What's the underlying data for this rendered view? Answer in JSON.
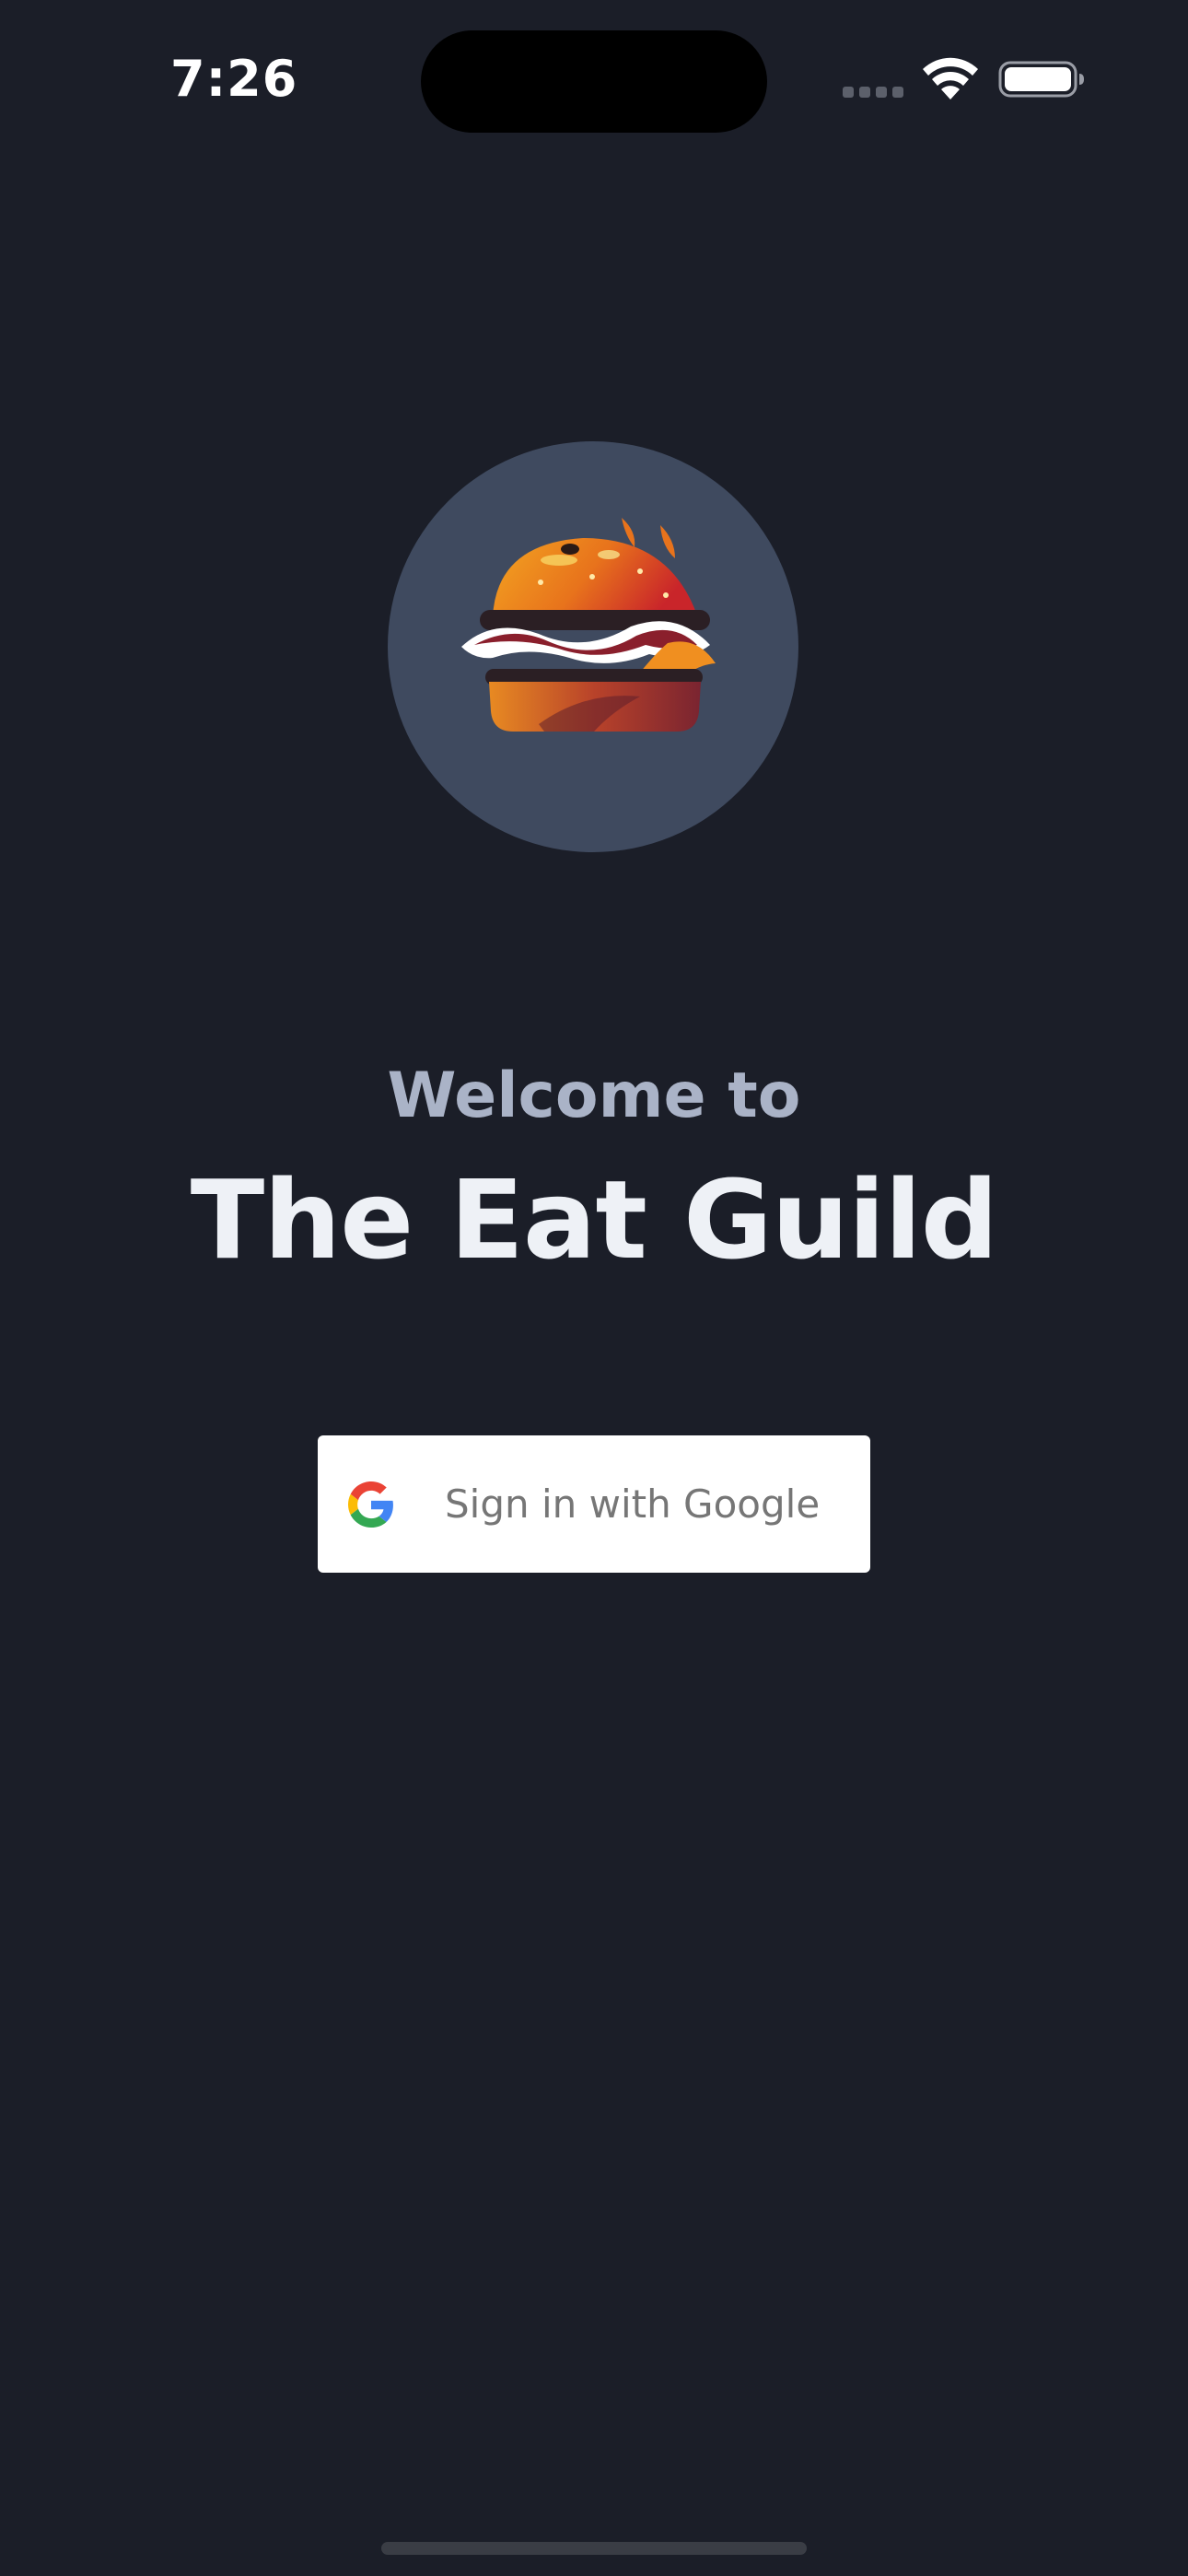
{
  "status_bar": {
    "time": "7:26",
    "signal_icon": "cellular-signal-icon",
    "wifi_icon": "wifi-icon",
    "battery_icon": "battery-icon"
  },
  "logo": {
    "icon": "burger-icon"
  },
  "welcome": {
    "subtitle": "Welcome to",
    "title": "The Eat Guild"
  },
  "sign_in": {
    "label": "Sign in with Google",
    "icon": "google-icon"
  },
  "colors": {
    "background": "#1b1e28",
    "logo_circle": "#3f4a5f",
    "subtitle": "#aab3c7",
    "title": "#eef1f6",
    "button_bg": "#ffffff",
    "button_text": "#767676"
  }
}
